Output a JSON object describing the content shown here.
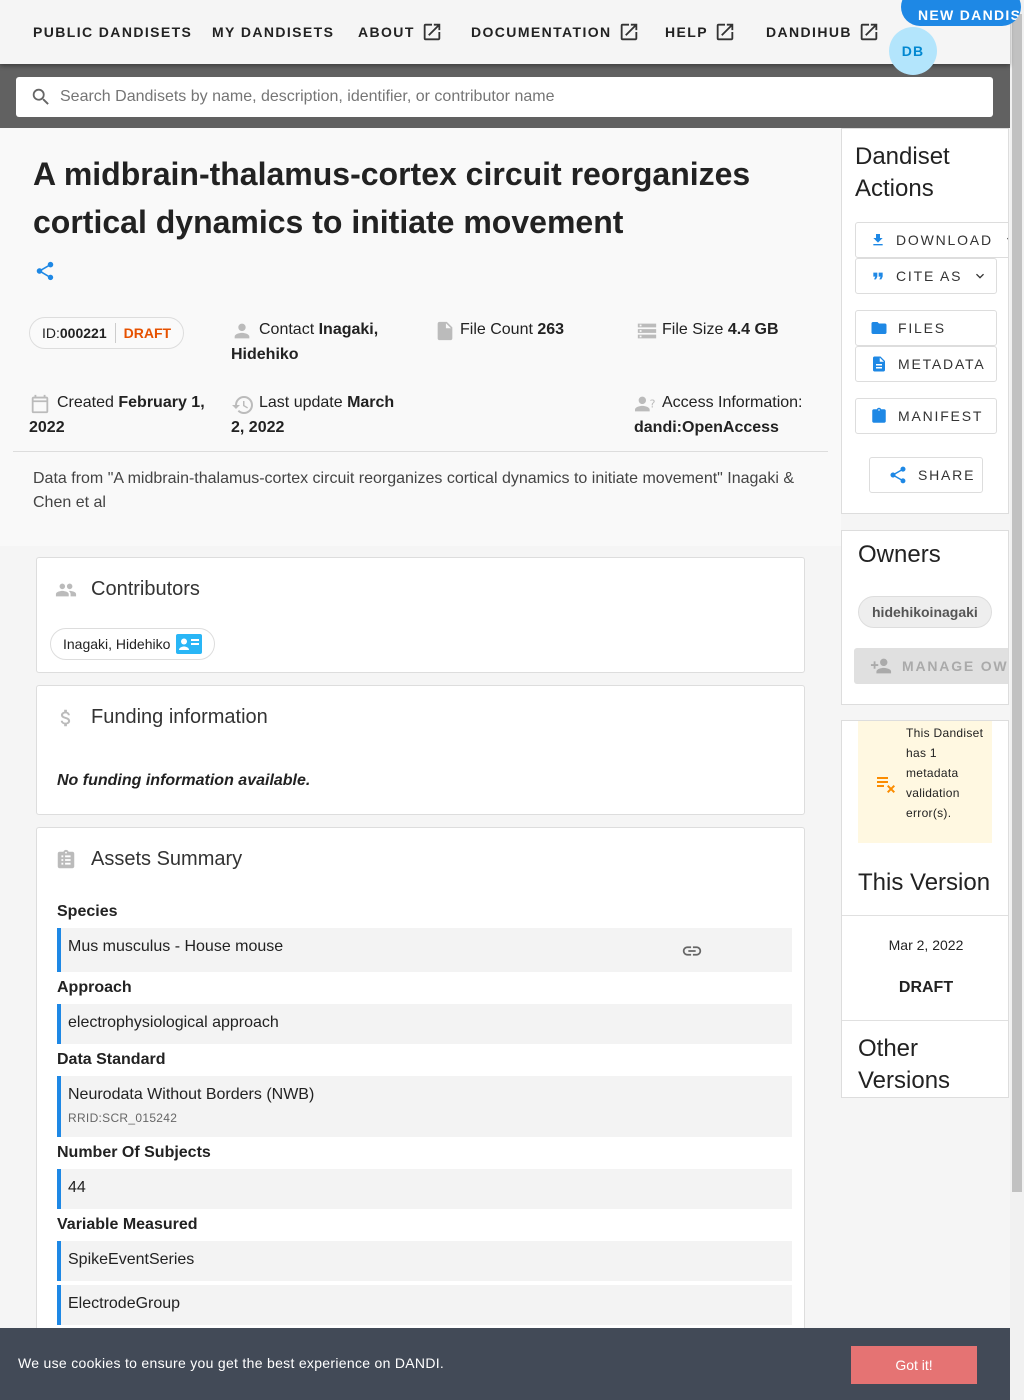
{
  "nav": {
    "items": [
      {
        "label": "PUBLIC DANDISETS",
        "external": false
      },
      {
        "label": "MY DANDISETS",
        "external": false
      },
      {
        "label": "ABOUT",
        "external": true
      },
      {
        "label": "DOCUMENTATION",
        "external": true
      },
      {
        "label": "HELP",
        "external": true
      },
      {
        "label": "DANDIHUB",
        "external": true
      }
    ],
    "new_button": "NEW DANDISET",
    "avatar_initials": "DB"
  },
  "search": {
    "placeholder": "Search Dandisets by name, description, identifier, or contributor name",
    "value": ""
  },
  "dandiset": {
    "title": "A midbrain-thalamus-cortex circuit reorganizes cortical dynamics to initiate movement",
    "id_prefix": "ID:",
    "id": "000221",
    "status": "DRAFT",
    "contact_label": "Contact",
    "contact": "Inagaki, Hidehiko",
    "file_count_label": "File Count",
    "file_count": "263",
    "file_size_label": "File Size",
    "file_size": "4.4 GB",
    "created_label": "Created",
    "created": "February 1, 2022",
    "updated_label": "Last update",
    "updated": "March 2, 2022",
    "access_label": "Access Information:",
    "access": "dandi:OpenAccess",
    "description": "Data from \"A midbrain-thalamus-cortex circuit reorganizes cortical dynamics to initiate movement\" Inagaki & Chen et al"
  },
  "contributors": {
    "heading": "Contributors",
    "people": [
      "Inagaki, Hidehiko"
    ]
  },
  "funding": {
    "heading": "Funding information",
    "empty_text": "No funding information available."
  },
  "assets": {
    "heading": "Assets Summary",
    "sections": [
      {
        "label": "Species",
        "values": [
          {
            "text": "Mus musculus - House mouse",
            "sub": "",
            "link": true
          }
        ]
      },
      {
        "label": "Approach",
        "values": [
          {
            "text": "electrophysiological approach",
            "sub": "",
            "link": false
          }
        ]
      },
      {
        "label": "Data Standard",
        "values": [
          {
            "text": "Neurodata Without Borders (NWB)",
            "sub": "RRID:SCR_015242",
            "link": false
          }
        ]
      },
      {
        "label": "Number Of Subjects",
        "values": [
          {
            "text": "44",
            "sub": "",
            "link": false
          }
        ]
      },
      {
        "label": "Variable Measured",
        "values": [
          {
            "text": "SpikeEventSeries",
            "sub": "",
            "link": false
          },
          {
            "text": "ElectrodeGroup",
            "sub": "",
            "link": false
          }
        ]
      }
    ]
  },
  "actions": {
    "title": "Dandiset Actions",
    "download": "DOWNLOAD",
    "cite": "CITE AS",
    "files": "FILES",
    "metadata": "METADATA",
    "manifest": "MANIFEST",
    "share": "SHARE"
  },
  "owners": {
    "title": "Owners",
    "list": [
      "hidehikoinagaki"
    ],
    "manage": "MANAGE OWNERS"
  },
  "validation": {
    "text": "This Dandiset has 1 metadata validation error(s)."
  },
  "version": {
    "title": "This Version",
    "date": "Mar 2, 2022",
    "status": "DRAFT"
  },
  "other_versions": {
    "title": "Other Versions"
  },
  "cookie": {
    "text": "We use cookies to ensure you get the best experience on DANDI.",
    "button": "Got it!"
  },
  "colors": {
    "accent": "#1e88e5",
    "draft": "#e65100",
    "warning": "#fb8c00",
    "cookie_bg": "#424a57",
    "cookie_btn": "#e57373"
  }
}
